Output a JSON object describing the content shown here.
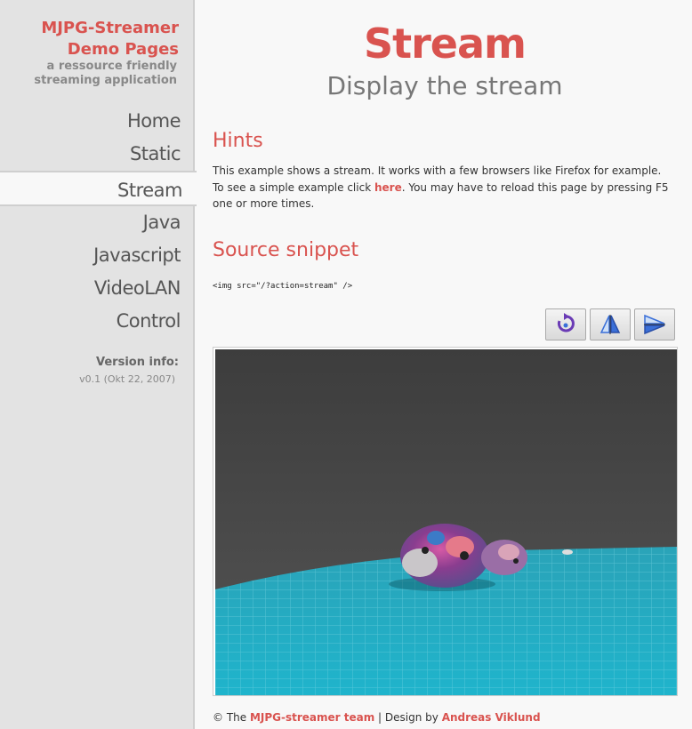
{
  "sidebar": {
    "brand_title": "MJPG-Streamer Demo Pages",
    "brand_subtitle": "a ressource friendly streaming application",
    "nav": [
      {
        "label": "Home"
      },
      {
        "label": "Static"
      },
      {
        "label": "Stream",
        "active": true
      },
      {
        "label": "Java"
      },
      {
        "label": "Javascript"
      },
      {
        "label": "VideoLAN"
      },
      {
        "label": "Control"
      }
    ],
    "version_label": "Version info:",
    "version_value": "v0.1 (Okt 22, 2007)"
  },
  "main": {
    "title": "Stream",
    "subtitle": "Display the stream",
    "hints_heading": "Hints",
    "hints_text_1": "This example shows a stream. It works with a few browsers like Firefox for example. To see a simple example click ",
    "hints_link": "here",
    "hints_text_2": ". You may have to reload this page by pressing F5 one or more times.",
    "source_heading": "Source snippet",
    "code": "<img src=\"/?action=stream\" />"
  },
  "toolbar": {
    "buttons": [
      {
        "icon": "rotate-icon"
      },
      {
        "icon": "flip-vertical-icon"
      },
      {
        "icon": "flip-horizontal-icon"
      }
    ]
  },
  "footer": {
    "prefix": "© The ",
    "team_link": "MJPG-streamer team",
    "middle": " | Design by ",
    "designer_link": "Andreas Viklund"
  },
  "colors": {
    "accent": "#d9534f",
    "sidebar_bg": "#e3e3e3",
    "page_bg": "#f8f8f8"
  }
}
